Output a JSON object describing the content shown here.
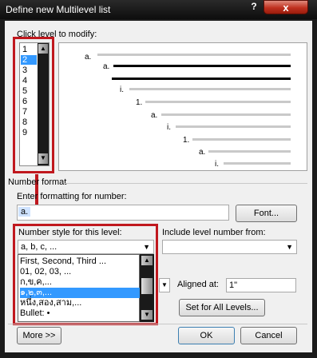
{
  "window": {
    "title": "Define new Multilevel list",
    "help_glyph": "?",
    "close_glyph": "x"
  },
  "level_picker": {
    "label": "Click level to modify:",
    "levels": [
      "1",
      "2",
      "3",
      "4",
      "5",
      "6",
      "7",
      "8",
      "9"
    ],
    "selected": "2",
    "scroll_up": "▲",
    "scroll_down": "▼"
  },
  "preview": {
    "labels": [
      "a.",
      "a.",
      "i.",
      "1.",
      "a.",
      "i.",
      "1.",
      "a.",
      "i."
    ]
  },
  "number_format": {
    "section_label": "Number format",
    "enter_label": "Enter formatting for number:",
    "format_value": "a.",
    "font_button": "Font...",
    "style_label": "Number style for this level:",
    "style_value": "a, b, c, ...",
    "include_label": "Include level number from:",
    "aligned_at_label": "Aligned at:",
    "aligned_at_value": "1\"",
    "set_all_button": "Set for All Levels..."
  },
  "style_dropdown": {
    "options": [
      "First, Second, Third ...",
      "01, 02, 03, ...",
      "ก,ข,ค,...",
      "๑,๒,๓,...",
      "หนึ่ง,สอง,สาม,...",
      "Bullet: •"
    ],
    "highlighted": "๑,๒,๓,...",
    "scroll_up": "▲",
    "scroll_down": "▼"
  },
  "footer": {
    "more_button": "More >>",
    "ok_button": "OK",
    "cancel_button": "Cancel"
  },
  "colors": {
    "highlight": "#3399ff",
    "annotation_red": "#c0181e",
    "titlebar": "#111111"
  }
}
